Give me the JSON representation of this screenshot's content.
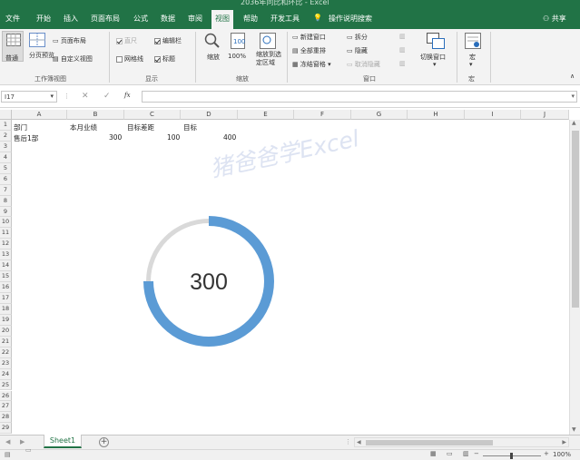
{
  "window": {
    "title": "2036年同比和环比 - Excel"
  },
  "menu": {
    "file": "文件",
    "home": "开始",
    "insert": "插入",
    "page_layout": "页面布局",
    "formulas": "公式",
    "data": "数据",
    "review": "审阅",
    "view": "视图",
    "help": "帮助",
    "developer": "开发工具",
    "tell_me": "操作说明搜索",
    "share": "共享"
  },
  "ribbon": {
    "workbook_views": {
      "normal": "普通",
      "page_break": "分页预览",
      "page_layout": "页面布局",
      "custom_views": "自定义视图",
      "group_label": "工作簿视图"
    },
    "show": {
      "ruler": "直尺",
      "formula_bar": "编辑栏",
      "gridlines": "网格线",
      "headings": "标题",
      "group_label": "显示"
    },
    "zoom": {
      "zoom": "缩放",
      "zoom_100": "100%",
      "zoom_selection": "缩放到选定区域",
      "group_label": "缩放"
    },
    "window": {
      "new_window": "新建窗口",
      "arrange_all": "全部重排",
      "freeze_panes": "冻结窗格",
      "split": "拆分",
      "hide": "隐藏",
      "unhide": "取消隐藏",
      "switch_windows": "切换窗口",
      "group_label": "窗口"
    },
    "macros": {
      "macros": "宏",
      "group_label": "宏"
    }
  },
  "formula_bar": {
    "name_box": "I17",
    "fx": "fx",
    "value": ""
  },
  "columns": [
    "A",
    "B",
    "C",
    "D",
    "E",
    "F",
    "G",
    "H",
    "I",
    "J"
  ],
  "rows": [
    "1",
    "2",
    "3",
    "4",
    "5",
    "6",
    "7",
    "8",
    "9",
    "10",
    "11",
    "12",
    "13",
    "14",
    "15",
    "16",
    "17",
    "18",
    "19",
    "20",
    "21",
    "22",
    "23",
    "24",
    "25",
    "26",
    "27",
    "28",
    "29"
  ],
  "cells": {
    "a1": "部门",
    "b1": "本月业绩",
    "c1": "目标差距",
    "d1": "目标",
    "a2": "售后1部",
    "b2": "300",
    "c2": "100",
    "d2": "400"
  },
  "watermark": "猪爸爸学Excel",
  "chart_data": {
    "type": "pie",
    "categories": [
      "本月业绩",
      "目标差距"
    ],
    "values": [
      300,
      100
    ],
    "center_label": "300",
    "colors": [
      "#5b9bd5",
      "#d9d9d9"
    ]
  },
  "sheet_tabs": {
    "active": "Sheet1"
  },
  "status": {
    "zoom": "100%"
  }
}
